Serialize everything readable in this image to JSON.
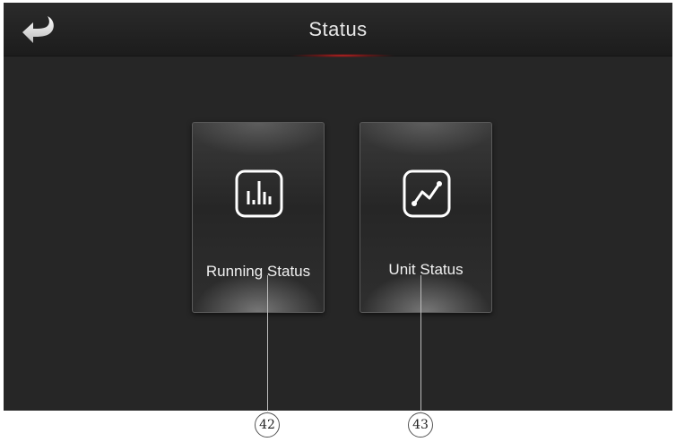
{
  "header": {
    "title": "Status",
    "back_icon": "back-arrow-icon"
  },
  "tiles": [
    {
      "label": "Running Status",
      "icon": "bar-chart-icon"
    },
    {
      "label": "Unit Status",
      "icon": "line-chart-icon"
    }
  ],
  "callouts": [
    "42",
    "43"
  ],
  "colors": {
    "background": "#262626",
    "header": "#1f1f1f",
    "accent": "#d42828",
    "text": "#f2f2f2"
  }
}
